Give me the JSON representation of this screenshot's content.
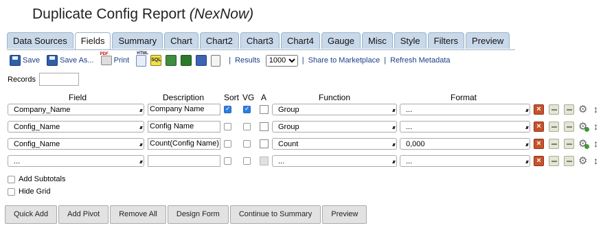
{
  "title": {
    "main": "Duplicate Config Report",
    "sub": "(NexNow)"
  },
  "tabs": [
    "Data Sources",
    "Fields",
    "Summary",
    "Chart",
    "Chart2",
    "Chart3",
    "Chart4",
    "Gauge",
    "Misc",
    "Style",
    "Filters",
    "Preview"
  ],
  "active_tab": "Fields",
  "toolbar": {
    "save": "Save",
    "save_as": "Save As...",
    "print": "Print",
    "pdf_tag": "PDF",
    "html_tag": "HTML",
    "sql_tag": "SQL",
    "results_label": "Results",
    "results_value": "1000",
    "share": "Share to Marketplace",
    "refresh": "Refresh Metadata",
    "separator": "|"
  },
  "records": {
    "label": "Records",
    "value": ""
  },
  "headers": {
    "field": "Field",
    "description": "Description",
    "sort": "Sort",
    "vg": "VG",
    "a": "A",
    "function": "Function",
    "format": "Format"
  },
  "rows": [
    {
      "field": "Company_Name",
      "description": "Company Name",
      "sort": true,
      "vg": true,
      "a": false,
      "a_disabled": false,
      "function": "Group",
      "format": "...",
      "gear_ok": false
    },
    {
      "field": "Config_Name",
      "description": "Config Name",
      "sort": false,
      "vg": false,
      "a": false,
      "a_disabled": false,
      "function": "Group",
      "format": "...",
      "gear_ok": true
    },
    {
      "field": "Config_Name",
      "description": "Count(Config Name)",
      "sort": false,
      "vg": false,
      "a": false,
      "a_disabled": false,
      "function": "Count",
      "format": "0,000",
      "gear_ok": true
    },
    {
      "field": "...",
      "description": "",
      "sort": false,
      "vg": false,
      "a": false,
      "a_disabled": true,
      "function": "...",
      "format": "...",
      "gear_ok": false
    }
  ],
  "options": {
    "add_subtotals": "Add Subtotals",
    "hide_grid": "Hide Grid"
  },
  "buttons": {
    "quick_add": "Quick Add",
    "add_pivot": "Add Pivot",
    "remove_all": "Remove All",
    "design_form": "Design Form",
    "continue": "Continue to Summary",
    "preview": "Preview"
  },
  "icons": {
    "x": "×",
    "gear": "⚙",
    "updown": "↕",
    "arrow": "⬍"
  },
  "colors": {
    "tab_bg": "#c9d9ea",
    "link": "#1a3d8a",
    "delete": "#c8532b",
    "check": "#2f7ee0"
  }
}
